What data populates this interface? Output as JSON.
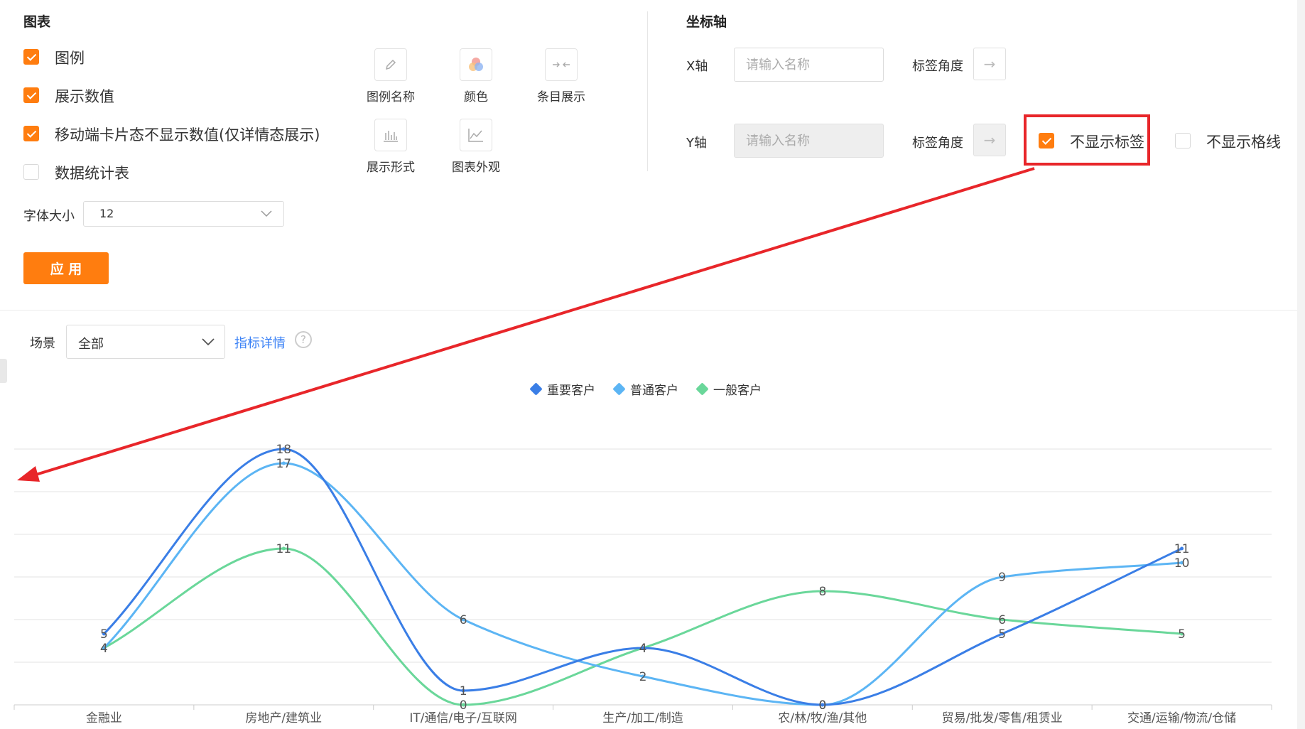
{
  "chart_panel": {
    "title": "图表",
    "checkboxes": [
      {
        "label": "图例",
        "checked": true
      },
      {
        "label": "展示数值",
        "checked": true
      },
      {
        "label": "移动端卡片态不显示数值(仅详情态展示)",
        "checked": true
      },
      {
        "label": "数据统计表",
        "checked": false
      }
    ],
    "font_size_label": "字体大小",
    "font_size_value": "12",
    "apply_label": "应 用",
    "tools": [
      {
        "label": "图例名称",
        "icon": "pencil-icon"
      },
      {
        "label": "颜色",
        "icon": "palette-icon"
      },
      {
        "label": "条目展示",
        "icon": "collapse-arrows-icon"
      },
      {
        "label": "展示形式",
        "icon": "bar-chart-icon"
      },
      {
        "label": "图表外观",
        "icon": "line-chart-icon"
      }
    ]
  },
  "axis_panel": {
    "title": "坐标轴",
    "x_label": "X轴",
    "y_label": "Y轴",
    "name_placeholder": "请输入名称",
    "tick_angle_label": "标签角度",
    "arrow_icon": "→",
    "hide_labels": {
      "label": "不显示标签",
      "checked": true
    },
    "hide_gridlines": {
      "label": "不显示格线",
      "checked": false
    }
  },
  "filter": {
    "scene_label": "场景",
    "scene_value": "全部",
    "metric_link": "指标详情",
    "help_icon": "?"
  },
  "colors": {
    "accent": "#ff7d0f",
    "annotation": "#e8262a",
    "link": "#3b82f6"
  },
  "chart_data": {
    "type": "line",
    "smooth": true,
    "categories": [
      "金融业",
      "房地产/建筑业",
      "IT/通信/电子/互联网",
      "生产/加工/制造",
      "农/林/牧/渔/其他",
      "贸易/批发/零售/租赁业",
      "交通/运输/物流/仓储"
    ],
    "series": [
      {
        "name": "重要客户",
        "color": "#3a7ee6",
        "values": [
          5,
          18,
          1,
          4,
          0,
          5,
          11
        ]
      },
      {
        "name": "普通客户",
        "color": "#5cb5f4",
        "values": [
          4,
          17,
          6,
          2,
          0,
          9,
          10
        ]
      },
      {
        "name": "一般客户",
        "color": "#6ad79a",
        "values": [
          4,
          11,
          0,
          4,
          8,
          6,
          5
        ]
      }
    ],
    "ylim": [
      0,
      18
    ],
    "y_tick_labels_shown": false,
    "grid": true,
    "legend_position": "top-center"
  }
}
